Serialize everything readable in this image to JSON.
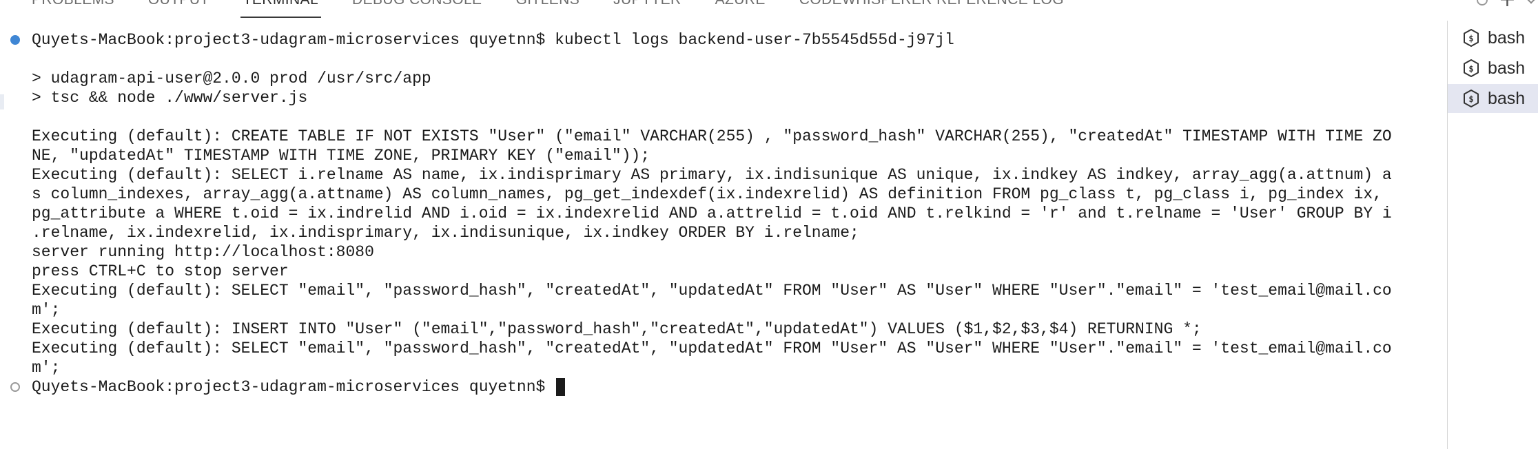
{
  "panel": {
    "tabs": [
      {
        "label": "PROBLEMS"
      },
      {
        "label": "OUTPUT"
      },
      {
        "label": "TERMINAL",
        "active": true
      },
      {
        "label": "DEBUG CONSOLE"
      },
      {
        "label": "GITLENS"
      },
      {
        "label": "JUPYTER"
      },
      {
        "label": "AZURE"
      },
      {
        "label": "CODEWHISPERER REFERENCE LOG"
      }
    ],
    "actions": [
      {
        "icon": "circle-icon"
      },
      {
        "icon": "plus-icon"
      },
      {
        "icon": "chevron-down-icon"
      }
    ]
  },
  "terminal": {
    "prompt": "Quyets-MacBook:project3-udagram-microservices quyetnn$ ",
    "lines": [
      {
        "text": "Quyets-MacBook:project3-udagram-microservices quyetnn$ kubectl logs backend-user-7b5545d55d-j97jl",
        "decoration": "success"
      },
      {
        "text": ""
      },
      {
        "text": "> udagram-api-user@2.0.0 prod /usr/src/app"
      },
      {
        "text": "> tsc && node ./www/server.js"
      },
      {
        "text": ""
      },
      {
        "text": "Executing (default): CREATE TABLE IF NOT EXISTS \"User\" (\"email\" VARCHAR(255) , \"password_hash\" VARCHAR(255), \"createdAt\" TIMESTAMP WITH TIME ZO"
      },
      {
        "text": "NE, \"updatedAt\" TIMESTAMP WITH TIME ZONE, PRIMARY KEY (\"email\"));"
      },
      {
        "text": "Executing (default): SELECT i.relname AS name, ix.indisprimary AS primary, ix.indisunique AS unique, ix.indkey AS indkey, array_agg(a.attnum) a"
      },
      {
        "text": "s column_indexes, array_agg(a.attname) AS column_names, pg_get_indexdef(ix.indexrelid) AS definition FROM pg_class t, pg_class i, pg_index ix,"
      },
      {
        "text": "pg_attribute a WHERE t.oid = ix.indrelid AND i.oid = ix.indexrelid AND a.attrelid = t.oid AND t.relkind = 'r' and t.relname = 'User' GROUP BY i"
      },
      {
        "text": ".relname, ix.indexrelid, ix.indisprimary, ix.indisunique, ix.indkey ORDER BY i.relname;"
      },
      {
        "text": "server running http://localhost:8080"
      },
      {
        "text": "press CTRL+C to stop server"
      },
      {
        "text": "Executing (default): SELECT \"email\", \"password_hash\", \"createdAt\", \"updatedAt\" FROM \"User\" AS \"User\" WHERE \"User\".\"email\" = 'test_email@mail.co"
      },
      {
        "text": "m';"
      },
      {
        "text": "Executing (default): INSERT INTO \"User\" (\"email\",\"password_hash\",\"createdAt\",\"updatedAt\") VALUES ($1,$2,$3,$4) RETURNING *;"
      },
      {
        "text": "Executing (default): SELECT \"email\", \"password_hash\", \"createdAt\", \"updatedAt\" FROM \"User\" AS \"User\" WHERE \"User\".\"email\" = 'test_email@mail.co"
      },
      {
        "text": "m';"
      }
    ]
  },
  "terminal_list": {
    "items": [
      {
        "label": "bash",
        "icon": "terminal-shell-icon",
        "active": false
      },
      {
        "label": "bash",
        "icon": "terminal-shell-icon",
        "active": false
      },
      {
        "label": "bash",
        "icon": "terminal-shell-icon",
        "active": true
      }
    ]
  }
}
